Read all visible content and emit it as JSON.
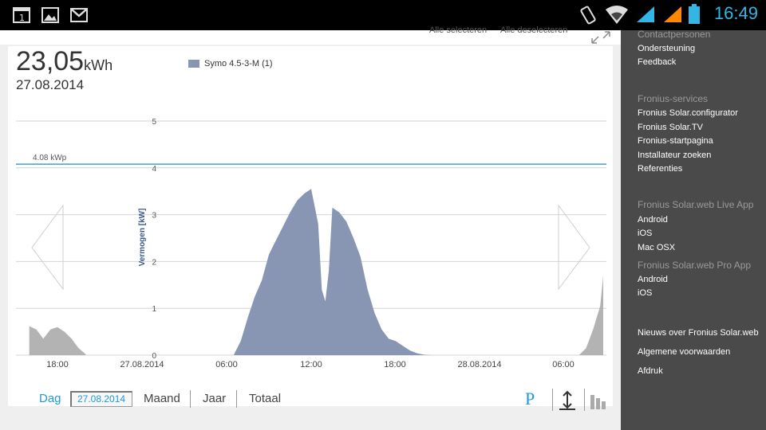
{
  "status_bar": {
    "time": "16:49",
    "icons": [
      "notification-1-icon",
      "image-icon",
      "gmail-icon",
      "vibrate-icon",
      "wifi-icon",
      "signal-icon",
      "signal-icon",
      "battery-icon"
    ],
    "colors": {
      "bar": "#000000",
      "time": "#33b5e5",
      "signal_blue": "#33b5e5",
      "signal_orange": "#ff8800"
    }
  },
  "toolbar": {
    "select_all": "Alle selecteren",
    "deselect_all": "Alle deselecteren"
  },
  "summary": {
    "energy_value": "23,05",
    "energy_unit": "kWh",
    "date": "27.08.2014"
  },
  "legend": {
    "series": "Symo 4.5-3-M (1)",
    "color": "#8896b4"
  },
  "chart_data": {
    "type": "area",
    "ylabel": "Vermogen [kW]",
    "ylim": [
      0,
      5
    ],
    "yticks": [
      "0",
      "1",
      "2",
      "3",
      "4",
      "5"
    ],
    "peak_line": {
      "label": "4.08 kWp",
      "value": 4.08,
      "color": "#1e88c8"
    },
    "xticks": [
      "18:00",
      "27.08.2014",
      "06:00",
      "12:00",
      "18:00",
      "28.08.2014",
      "06:00"
    ],
    "series": [
      {
        "name": "Symo 4.5-3-M (1)",
        "color": "#8896b4",
        "x": [
          "06:30",
          "07:00",
          "07:30",
          "08:00",
          "08:30",
          "09:00",
          "09:30",
          "10:00",
          "10:30",
          "11:00",
          "11:30",
          "12:00",
          "12:30",
          "12:45",
          "13:00",
          "13:15",
          "13:30",
          "14:00",
          "14:30",
          "15:00",
          "15:30",
          "16:00",
          "16:30",
          "17:00",
          "17:30",
          "18:00",
          "18:30",
          "19:00",
          "19:30",
          "20:00",
          "20:30"
        ],
        "values": [
          0,
          0.3,
          0.8,
          1.25,
          1.6,
          2.15,
          2.45,
          2.75,
          3.05,
          3.3,
          3.45,
          3.55,
          2.8,
          1.4,
          1.15,
          1.8,
          3.15,
          3.05,
          2.85,
          2.5,
          2.1,
          1.4,
          0.9,
          0.55,
          0.35,
          0.3,
          0.2,
          0.1,
          0.04,
          0.01,
          0
        ]
      }
    ],
    "context_series": {
      "color": "#b3b3b3",
      "previous_day_x": [
        "16:00",
        "16:30",
        "17:00",
        "17:30",
        "18:00",
        "18:30",
        "19:00",
        "19:30",
        "20:00"
      ],
      "previous_day_values": [
        0.62,
        0.55,
        0.35,
        0.55,
        0.6,
        0.5,
        0.35,
        0.15,
        0.02
      ],
      "next_day_x": [
        "07:00",
        "07:30",
        "08:00",
        "08:30",
        "09:00"
      ],
      "next_day_values": [
        0,
        0.15,
        0.55,
        1.05,
        1.7
      ]
    }
  },
  "controls": {
    "day": "Dag",
    "date_input": "27.08.2014",
    "month": "Maand",
    "year": "Jaar",
    "total": "Totaal",
    "p_button": "P"
  },
  "sidebar": {
    "contact": "Contactpersonen",
    "support": "Ondersteuning",
    "feedback": "Feedback",
    "services_header": "Fronius-services",
    "services": [
      "Fronius Solar.configurator",
      "Fronius Solar.TV",
      "Fronius-startpagina",
      "Installateur zoeken",
      "Referenties"
    ],
    "live_header": "Fronius Solar.web Live App",
    "live": [
      "Android",
      "iOS",
      "Mac OSX"
    ],
    "pro_header": "Fronius Solar.web Pro App",
    "pro": [
      "Android",
      "iOS"
    ],
    "news": "Nieuws over Fronius Solar.web",
    "terms": "Algemene voorwaarden",
    "print": "Afdruk"
  }
}
